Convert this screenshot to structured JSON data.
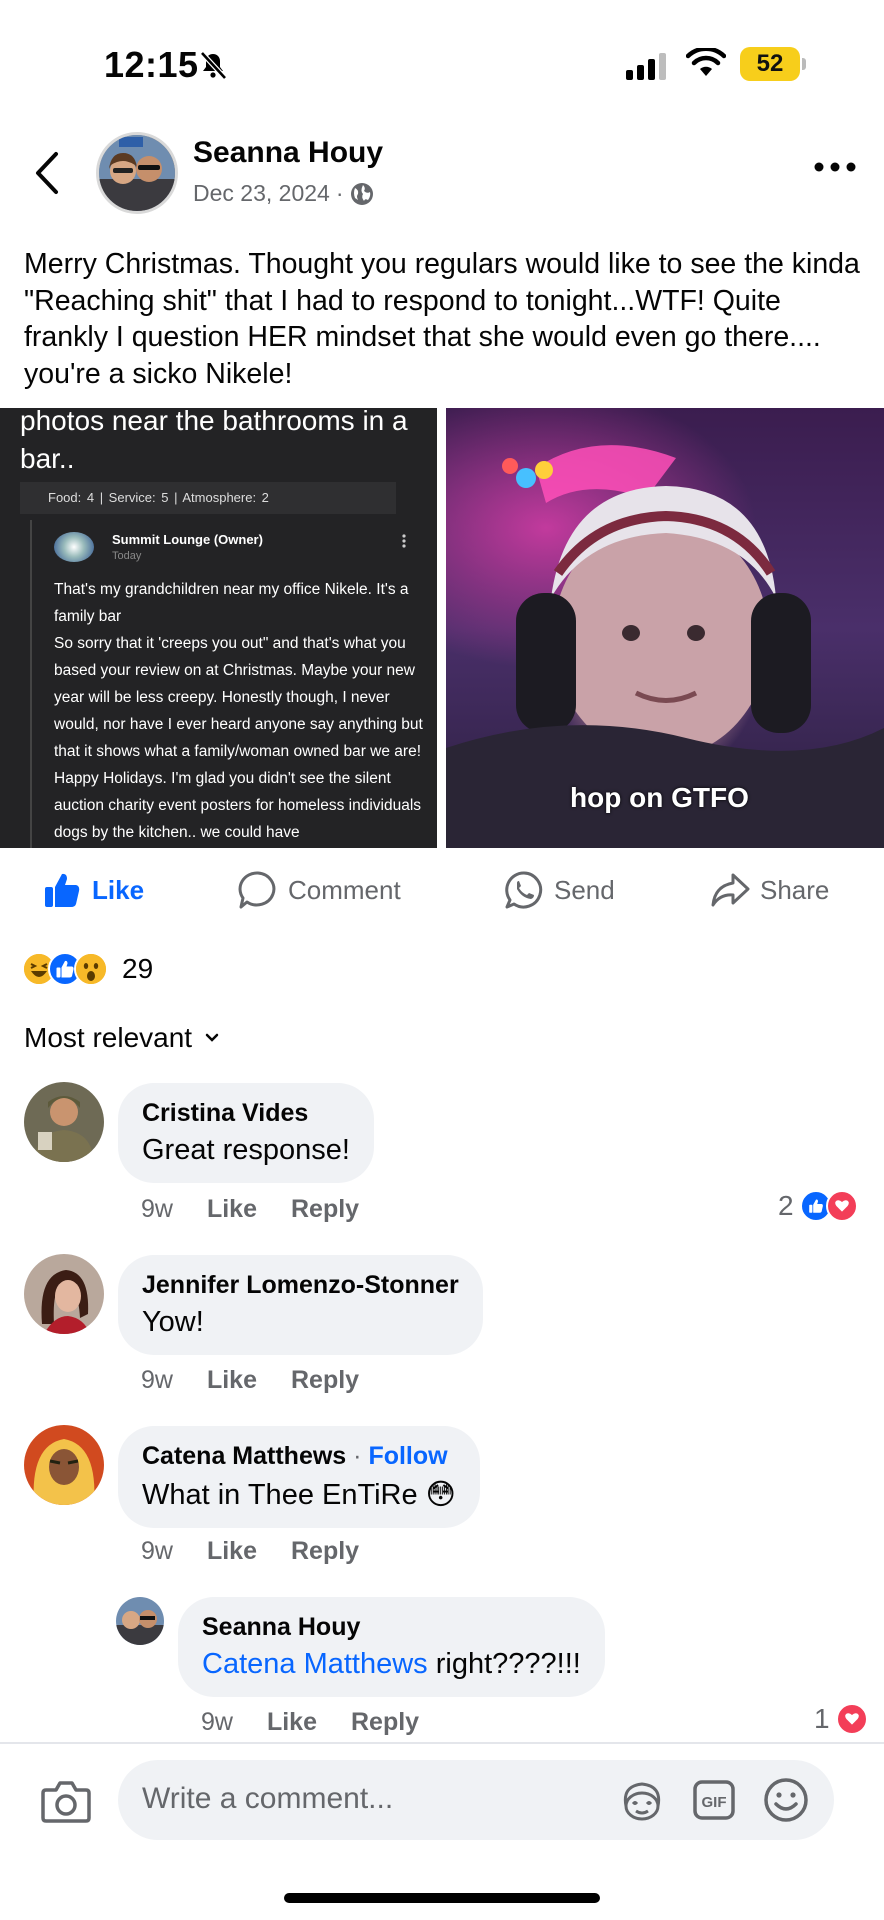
{
  "status_bar": {
    "time": "12:15",
    "battery": "52"
  },
  "post": {
    "author": "Seanna Houy",
    "date": "Dec 23, 2024",
    "separator": "·",
    "text": "Merry Christmas.  Thought you regulars would like to see the kinda \"Reaching shit\" that I had to respond to tonight...WTF! Quite frankly I question HER mindset that she would even go there.... you're a sicko Nikele!",
    "image_left": {
      "heading": "photos near the bathrooms in a bar..",
      "ratings": "Food: 4  |  Service: 5  |  Atmosphere: 2",
      "owner_name": "Summit Lounge (Owner)",
      "owner_time": "Today",
      "owner_text": "That's my grandchildren near my office Nikele. It's a family bar\n So  sorry that it 'creeps you out\" and that's what you based your review on at Christmas. Maybe your new year will be less creepy. Honestly though,  I never would, nor have I ever heard anyone say anything but that it shows what a family/woman owned bar we are!  Happy Holidays.  I'm glad you didn't see the silent auction charity event posters for homeless individuals dogs by the kitchen.. we could have"
    },
    "image_right": {
      "caption": "hop on GTFO"
    },
    "actions": {
      "like": "Like",
      "comment": "Comment",
      "send": "Send",
      "share": "Share"
    },
    "reaction_count": "29",
    "sort_label": "Most relevant"
  },
  "comments": [
    {
      "name": "Cristina Vides",
      "text": "Great response!",
      "time": "9w",
      "like": "Like",
      "reply": "Reply",
      "reaction_count": "2"
    },
    {
      "name": "Jennifer Lomenzo-Stonner",
      "text": "Yow!",
      "time": "9w",
      "like": "Like",
      "reply": "Reply"
    },
    {
      "name": "Catena Matthews",
      "follow": "Follow",
      "follow_sep": " · ",
      "text": "What in Thee EnTiRe 😳",
      "time": "9w",
      "like": "Like",
      "reply": "Reply"
    },
    {
      "name": "Seanna Houy",
      "mention": "Catena Matthews",
      "text": " right????!!!",
      "time": "9w",
      "like": "Like",
      "reply": "Reply",
      "reaction_count": "1"
    }
  ],
  "composer": {
    "placeholder": "Write a comment..."
  },
  "colors": {
    "accent": "#0866ff",
    "secondary_text": "#65676b",
    "bubble": "#f0f2f5",
    "love": "#f33e58"
  }
}
